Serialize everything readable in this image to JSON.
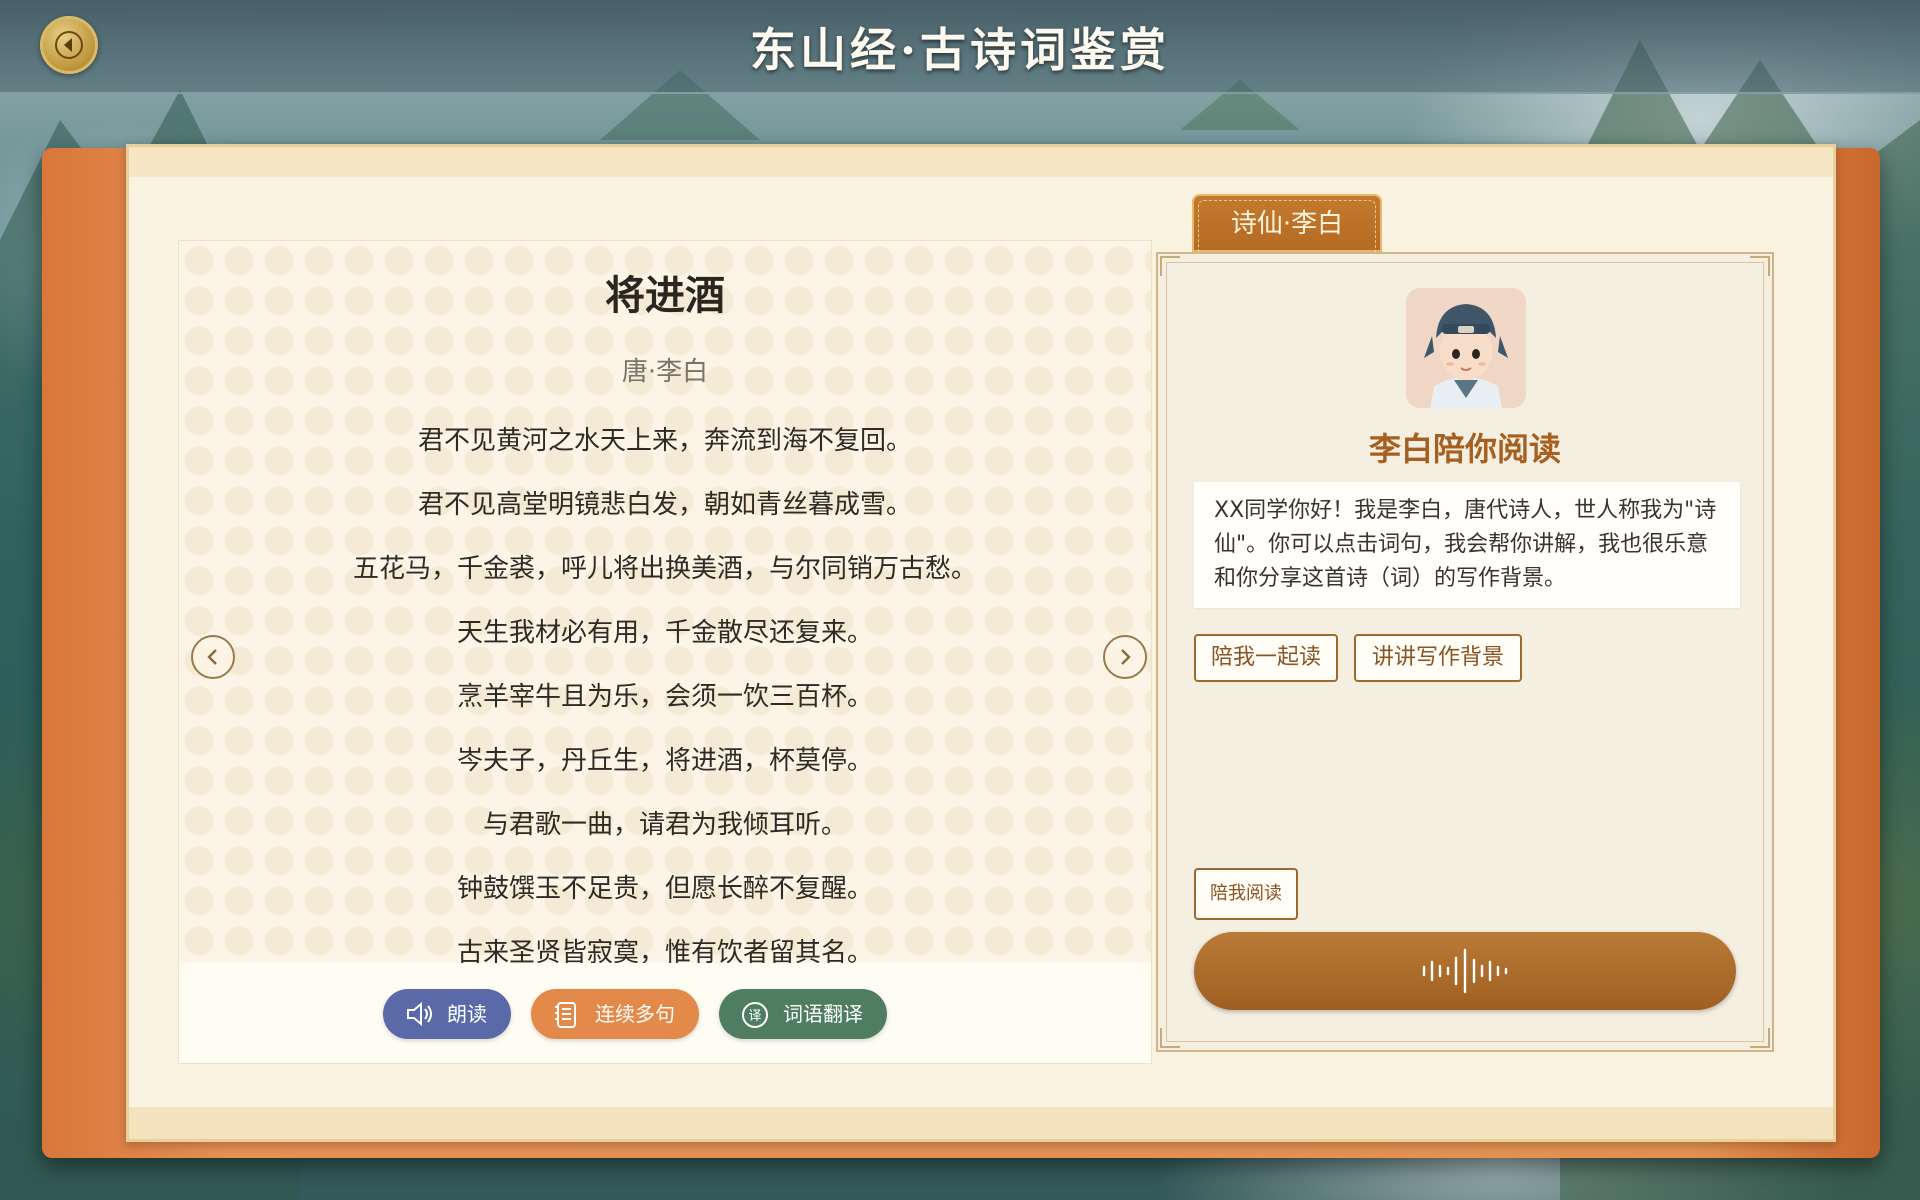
{
  "header": {
    "back_label": "",
    "title": "东山经·古诗词鉴赏"
  },
  "poem": {
    "title": "将进酒",
    "author": "唐·李白",
    "lines": [
      "君不见黄河之水天上来，奔流到海不复回。",
      "君不见高堂明镜悲白发，朝如青丝暮成雪。",
      "五花马，千金裘，呼儿将出换美酒，与尔同销万古愁。",
      "天生我材必有用，千金散尽还复来。",
      "烹羊宰牛且为乐，会须一饮三百杯。",
      "岑夫子，丹丘生，将进酒，杯莫停。",
      "与君歌一曲，请君为我倾耳听。",
      "钟鼓馔玉不足贵，但愿长醉不复醒。",
      "古来圣贤皆寂寞，惟有饮者留其名。"
    ]
  },
  "toolbar": {
    "read_aloud": "朗读",
    "continuous": "连续多句",
    "translate": "词语翻译",
    "colors": {
      "read_aloud": "#5a6aa8",
      "continuous": "#e3894a",
      "translate": "#4f7d5f"
    }
  },
  "assistant": {
    "tab_label": "诗仙·李白",
    "name": "李白陪你阅读",
    "message": "XX同学你好！我是李白，唐代诗人，世人称我为\"诗仙\"。你可以点击词句，我会帮你讲解，我也很乐意和你分享这首诗（词）的写作背景。",
    "actions": {
      "read_together": "陪我一起读",
      "background": "讲讲写作背景"
    },
    "read_with_me": "陪我阅读"
  },
  "icons": {
    "back": "back-arrow-icon",
    "prev": "chevron-left-icon",
    "next": "chevron-right-icon",
    "speaker": "speaker-icon",
    "list": "list-icon",
    "translate": "translate-icon",
    "voice": "voice-wave-icon"
  }
}
